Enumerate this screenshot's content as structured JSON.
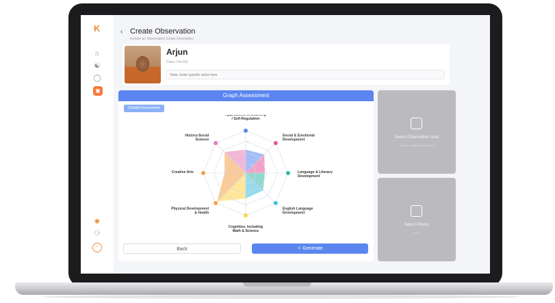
{
  "header": {
    "title": "Create Observation",
    "subtitle": "Include an Observation Grade Description"
  },
  "student": {
    "name": "Arjun",
    "meta": "Class: Pre-KG",
    "note_placeholder": "Note: Enter specific notes here"
  },
  "graph": {
    "header": "Graph Assessment",
    "chip": "Detailed Assessment"
  },
  "chart_data": {
    "type": "radar",
    "axes": [
      "Approaches to Learning / Self-Regulation",
      "Social & Emotional Development",
      "Language & Literacy Development",
      "English Language Development",
      "Cognition, Including Math & Science",
      "Physical Development & Health",
      "Creative Arts",
      "History-Social Science"
    ],
    "values": [
      0.55,
      0.62,
      0.45,
      0.58,
      0.6,
      0.95,
      0.5,
      0.7
    ],
    "axis_colors": [
      "#5b86f0",
      "#e8559a",
      "#35b8a9",
      "#3fbfe0",
      "#ffd44a",
      "#f6a046",
      "#f6a046",
      "#e87bb8"
    ],
    "ticks": [
      "1",
      "2",
      "3",
      "4"
    ]
  },
  "actions": {
    "back_label": "Back",
    "generate_label": "✧ Generate"
  },
  "date_card": {
    "label": "Select Observation Date",
    "sub": "Choose a date for this record"
  },
  "photos_card": {
    "label": "Select Photos",
    "sub": "or link"
  },
  "colors": {
    "accent": "#f6793d",
    "primary": "#5b86f0"
  }
}
